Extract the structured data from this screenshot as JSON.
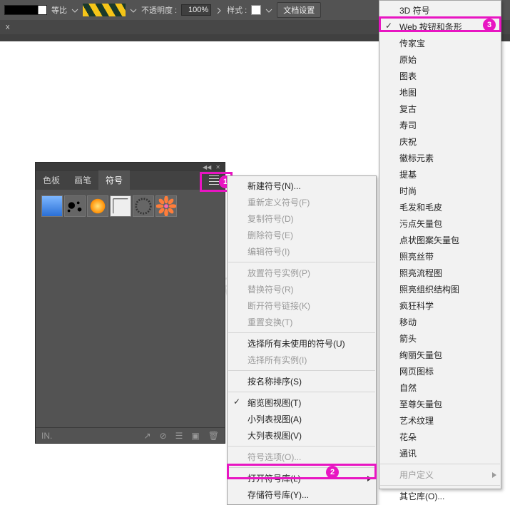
{
  "toolbar": {
    "ratio_label": "等比",
    "opacity_label": "不透明度 :",
    "opacity_value": "100%",
    "style_label": "样式 :",
    "doc_settings": "文档设置",
    "x": "x"
  },
  "panel": {
    "tabs": [
      "色板",
      "画笔",
      "符号"
    ],
    "footer_left": "IN.",
    "burger_name": "panel-menu-icon"
  },
  "badges": {
    "b1": "1",
    "b2": "2",
    "b3": "3"
  },
  "menu1": [
    {
      "t": "item",
      "label": "新建符号(N)..."
    },
    {
      "t": "item",
      "label": "重新定义符号(F)",
      "disabled": true
    },
    {
      "t": "item",
      "label": "复制符号(D)",
      "disabled": true
    },
    {
      "t": "item",
      "label": "删除符号(E)",
      "disabled": true
    },
    {
      "t": "item",
      "label": "编辑符号(I)",
      "disabled": true
    },
    {
      "t": "sep"
    },
    {
      "t": "item",
      "label": "放置符号实例(P)",
      "disabled": true
    },
    {
      "t": "item",
      "label": "替换符号(R)",
      "disabled": true
    },
    {
      "t": "item",
      "label": "断开符号链接(K)",
      "disabled": true
    },
    {
      "t": "item",
      "label": "重置变换(T)",
      "disabled": true
    },
    {
      "t": "sep"
    },
    {
      "t": "item",
      "label": "选择所有未使用的符号(U)"
    },
    {
      "t": "item",
      "label": "选择所有实例(I)",
      "disabled": true
    },
    {
      "t": "sep"
    },
    {
      "t": "item",
      "label": "按名称排序(S)"
    },
    {
      "t": "sep"
    },
    {
      "t": "item",
      "label": "缩览图视图(T)",
      "checked": true
    },
    {
      "t": "item",
      "label": "小列表视图(A)"
    },
    {
      "t": "item",
      "label": "大列表视图(V)"
    },
    {
      "t": "sep"
    },
    {
      "t": "item",
      "label": "符号选项(O)...",
      "disabled": true
    },
    {
      "t": "sep"
    },
    {
      "t": "item",
      "label": "打开符号库(L)",
      "sub": true,
      "hl": true
    },
    {
      "t": "item",
      "label": "存储符号库(Y)..."
    }
  ],
  "menu2": [
    {
      "t": "item",
      "label": "3D 符号"
    },
    {
      "t": "item",
      "label": "Web 按钮和条形",
      "checked": true,
      "hl": true
    },
    {
      "t": "item",
      "label": "传家宝"
    },
    {
      "t": "item",
      "label": "原始"
    },
    {
      "t": "item",
      "label": "图表"
    },
    {
      "t": "item",
      "label": "地图"
    },
    {
      "t": "item",
      "label": "复古"
    },
    {
      "t": "item",
      "label": "寿司"
    },
    {
      "t": "item",
      "label": "庆祝"
    },
    {
      "t": "item",
      "label": "徽标元素"
    },
    {
      "t": "item",
      "label": "提基"
    },
    {
      "t": "item",
      "label": "时尚"
    },
    {
      "t": "item",
      "label": "毛发和毛皮"
    },
    {
      "t": "item",
      "label": "污点矢量包"
    },
    {
      "t": "item",
      "label": "点状图案矢量包"
    },
    {
      "t": "item",
      "label": "照亮丝带"
    },
    {
      "t": "item",
      "label": "照亮流程图"
    },
    {
      "t": "item",
      "label": "照亮组织结构图"
    },
    {
      "t": "item",
      "label": "疯狂科学"
    },
    {
      "t": "item",
      "label": "移动"
    },
    {
      "t": "item",
      "label": "箭头"
    },
    {
      "t": "item",
      "label": "绚丽矢量包"
    },
    {
      "t": "item",
      "label": "网页图标"
    },
    {
      "t": "item",
      "label": "自然"
    },
    {
      "t": "item",
      "label": "至尊矢量包"
    },
    {
      "t": "item",
      "label": "艺术纹理"
    },
    {
      "t": "item",
      "label": "花朵"
    },
    {
      "t": "item",
      "label": "通讯"
    },
    {
      "t": "sep"
    },
    {
      "t": "item",
      "label": "用户定义",
      "sub": true,
      "disabled": true
    },
    {
      "t": "sep"
    },
    {
      "t": "item",
      "label": "其它库(O)..."
    }
  ]
}
